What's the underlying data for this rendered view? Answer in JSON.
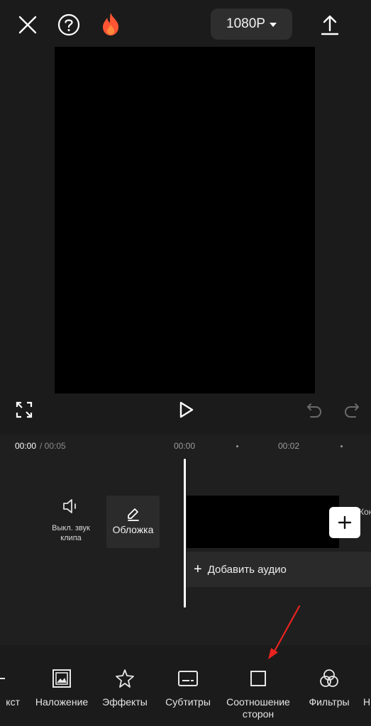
{
  "topbar": {
    "close_icon": "close-icon",
    "help_icon": "help-icon",
    "fire_icon": "fire-icon",
    "resolution": "1080P",
    "export_icon": "upload-icon",
    "fire_color": "#ff5533"
  },
  "player": {
    "fullscreen_icon": "fullscreen-icon",
    "play_icon": "play-icon",
    "undo_icon": "undo-icon",
    "redo_icon": "redo-icon"
  },
  "timeline": {
    "current_time": "00:00",
    "total_time": "/ 00:05",
    "ruler": [
      "00:00",
      "00:02"
    ],
    "mute_label": "Выкл. звук клипа",
    "cover_label": "Обложка",
    "clip_overflow_label": "Кон",
    "add_audio_label": "Добавить аудио",
    "add_audio_plus": "+"
  },
  "toolbar": {
    "items": [
      {
        "label": "кст",
        "icon": "text-icon"
      },
      {
        "label": "Наложение",
        "icon": "overlay-icon"
      },
      {
        "label": "Эффекты",
        "icon": "effects-icon"
      },
      {
        "label": "Субтитры",
        "icon": "subtitles-icon"
      },
      {
        "label": "Соотношение сторон",
        "icon": "aspect-ratio-icon"
      },
      {
        "label": "Фильтры",
        "icon": "filters-icon"
      },
      {
        "label": "Н",
        "icon": "next-tool-icon"
      }
    ]
  },
  "annotation": {
    "arrow_color": "#e8231f"
  }
}
